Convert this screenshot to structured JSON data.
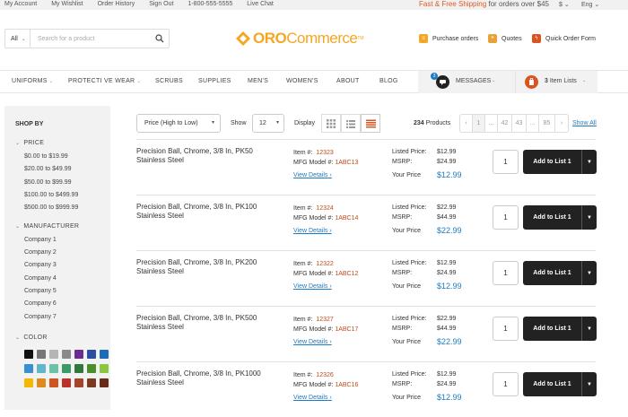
{
  "topbar": {
    "links": [
      "My Account",
      "My Wishlist",
      "Order History",
      "Sign Out",
      "1-800-555-5555",
      "Live Chat"
    ],
    "promo_highlight": "Fast & Free Shipping",
    "promo_rest": " for orders over $45",
    "currency": "$",
    "language": "Eng"
  },
  "header": {
    "search_category": "All",
    "search_placeholder": "Search for a product",
    "logo_oro": "ORO",
    "logo_commerce": "Commerce",
    "logo_tm": "TM",
    "purchase_orders": "Purchase orders",
    "quotes": "Quotes",
    "quick_order": "Quick Order Form"
  },
  "nav": {
    "items": [
      "UNIFORMS",
      "PROTECTI VE WEAR",
      "SCRUBS",
      "SUPPLIES",
      "MEN'S",
      "WOMEN'S",
      "ABOUT",
      "BLOG"
    ],
    "messages_badge": "3",
    "messages_label": "MESSAGES",
    "lists_count": "3",
    "lists_label": " Item Lists"
  },
  "sidebar": {
    "title": "SHOP BY",
    "price_title": "PRICE",
    "prices": [
      "$0.00 to $19.99",
      "$20.00 to $49.99",
      "$50.00 to $99.99",
      "$100.00 to $499.99",
      "$500.00 to $999.99"
    ],
    "manufacturer_title": "MANUFACTURER",
    "manufacturers": [
      "Company 1",
      "Company 2",
      "Company 3",
      "Company 4",
      "Company 5",
      "Company 6",
      "Company 7"
    ],
    "color_title": "COLOR",
    "colors": [
      "#111111",
      "#777777",
      "#b5b5b5",
      "#8a8a8a",
      "#6a2e8e",
      "#2b4fa0",
      "#1f6bb5",
      "#3a8fd0",
      "#5fb7c9",
      "#6cc2a8",
      "#3a9a6a",
      "#2f7a3a",
      "#4a8f2a",
      "#8cc63f",
      "#f5b800",
      "#e08a1e",
      "#d0541e",
      "#b8322a",
      "#a6442a",
      "#7a3b1e",
      "#6a2a1a"
    ]
  },
  "toolbar": {
    "sort_value": "Price (High to Low)",
    "show_label": "Show",
    "show_value": "12",
    "display_label": "Display",
    "count_number": "234",
    "count_label": " Products",
    "pages": [
      "‹",
      "1",
      "...",
      "42",
      "43",
      "...",
      "85",
      "›"
    ],
    "view_all": "Show All"
  },
  "products": [
    {
      "name": "Precision Ball, Chrome, 3/8 In, PK50 Stainless Steel",
      "item_label": "Item #:",
      "item": "12323",
      "mfg_label": "MFG Model #:",
      "mfg": "1ABC13",
      "details": "View Details",
      "listed_label": "Listed Price:",
      "listed": "$12.99",
      "msrp_label": "MSRP:",
      "msrp": "$24.99",
      "your_label": "Your Price",
      "your": "$12.99",
      "qty": "1",
      "add_label": "Add to List 1"
    },
    {
      "name": "Precision Ball, Chrome, 3/8 In, PK100 Stainless Steel",
      "item_label": "Item #:",
      "item": "12324",
      "mfg_label": "MFG Model #:",
      "mfg": "1ABC14",
      "details": "View Details",
      "listed_label": "Listed Price:",
      "listed": "$22.99",
      "msrp_label": "MSRP:",
      "msrp": "$44.99",
      "your_label": "Your Price",
      "your": "$22.99",
      "qty": "1",
      "add_label": "Add to List 1"
    },
    {
      "name": "Precision Ball, Chrome, 3/8 In, PK200 Stainless Steel",
      "item_label": "Item #:",
      "item": "12322",
      "mfg_label": "MFG Model #:",
      "mfg": "1ABC12",
      "details": "View Details",
      "listed_label": "Listed Price:",
      "listed": "$12.99",
      "msrp_label": "MSRP:",
      "msrp": "$24.99",
      "your_label": "Your Price",
      "your": "$12.99",
      "qty": "1",
      "add_label": "Add to List 1"
    },
    {
      "name": "Precision Ball, Chrome, 3/8 In, PK500 Stainless Steel",
      "item_label": "Item #:",
      "item": "12327",
      "mfg_label": "MFG Model #:",
      "mfg": "1ABC17",
      "details": "View Details",
      "listed_label": "Listed Price:",
      "listed": "$22.99",
      "msrp_label": "MSRP:",
      "msrp": "$44.99",
      "your_label": "Your Price",
      "your": "$22.99",
      "qty": "1",
      "add_label": "Add to List 1"
    },
    {
      "name": "Precision Ball, Chrome, 3/8 In, PK1000 Stainless Steel",
      "item_label": "Item #:",
      "item": "12326",
      "mfg_label": "MFG Model #:",
      "mfg": "1ABC16",
      "details": "View Details",
      "listed_label": "Listed Price:",
      "listed": "$12.99",
      "msrp_label": "MSRP:",
      "msrp": "$24.99",
      "your_label": "Your Price",
      "your": "$12.99",
      "qty": "1",
      "add_label": "Add to List 1"
    }
  ]
}
